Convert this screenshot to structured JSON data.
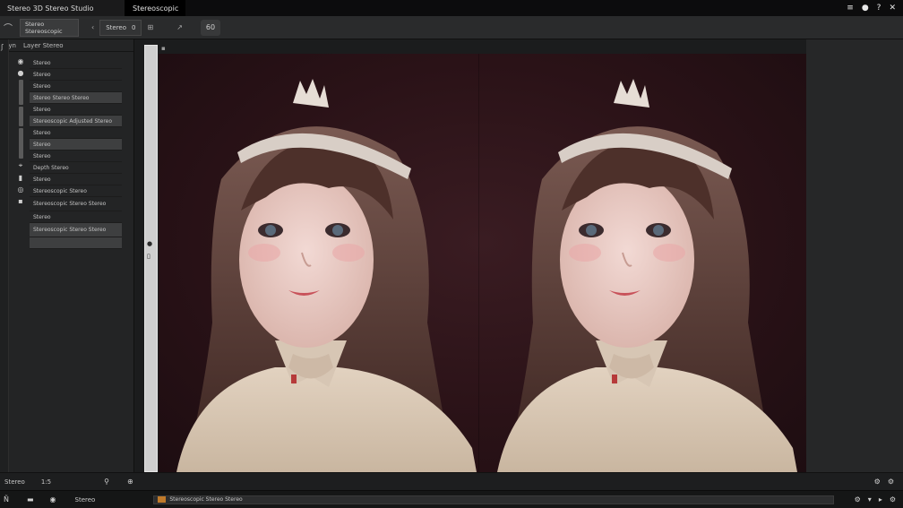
{
  "window": {
    "app_tab": "Stereo 3D Stereo Studio",
    "doc_tab": "Stereoscopic",
    "controls": [
      "≡",
      "●",
      "?",
      "✕"
    ]
  },
  "toolbar": {
    "preset_field": "Stereo Stereoscopic Adjustment",
    "mode_select": "Stereo",
    "mode_value": "0",
    "zoom_label": "60",
    "buttons": [
      "‹",
      "⊞",
      "↗"
    ]
  },
  "left_panel": {
    "tabs": [
      "Dyn",
      "Layer Stereo"
    ],
    "strip_icons": [
      "◉",
      "●",
      "▣",
      "⌖",
      "▮",
      "◎",
      "▪"
    ],
    "layers": [
      {
        "label": "Stereo",
        "selected": false
      },
      {
        "label": "Stereo",
        "selected": false
      },
      {
        "label": "Stereo",
        "selected": false
      },
      {
        "label": "Stereo Stereo Stereo",
        "selected": true
      },
      {
        "label": "Stereo",
        "selected": false
      },
      {
        "label": "Stereoscopic Adjusted Stereo",
        "selected": true
      },
      {
        "label": "Stereo",
        "selected": false
      },
      {
        "label": "Stereo",
        "selected": true
      },
      {
        "label": "Stereo",
        "selected": false
      },
      {
        "label": "Depth Stereo",
        "selected": false
      },
      {
        "label": "Stereo",
        "selected": false
      },
      {
        "label": "Stereoscopic Stereo",
        "selected": false
      },
      {
        "label": "Stereoscopic Stereo Stereo",
        "selected": false,
        "tall": true
      },
      {
        "label": "Stereo",
        "selected": false
      },
      {
        "label": "Stereoscopic Stereo Stereo",
        "selected": true,
        "tall": true
      },
      {
        "label": "",
        "selected": true
      }
    ]
  },
  "ruler": {
    "top_mark": "▪",
    "handle_a": "●",
    "handle_b": "▯"
  },
  "status": {
    "row1": [
      "Stereo",
      "1:5",
      "⚲",
      "⊕"
    ],
    "row1_right": [
      "⚙",
      "⚙"
    ],
    "row2": [
      "Ñ",
      "▬",
      "◉",
      "Stereo"
    ],
    "row2_track": "Stereoscopic Stereo Stereo",
    "row2_right": [
      "⚙",
      "▾",
      "▸",
      "⚙"
    ]
  },
  "colors": {
    "accent": "#c07a2a",
    "canvas_bg": "#2a1217"
  },
  "icons": [
    "search-icon",
    "gear-icon",
    "close-icon",
    "menu-icon",
    "help-icon"
  ]
}
